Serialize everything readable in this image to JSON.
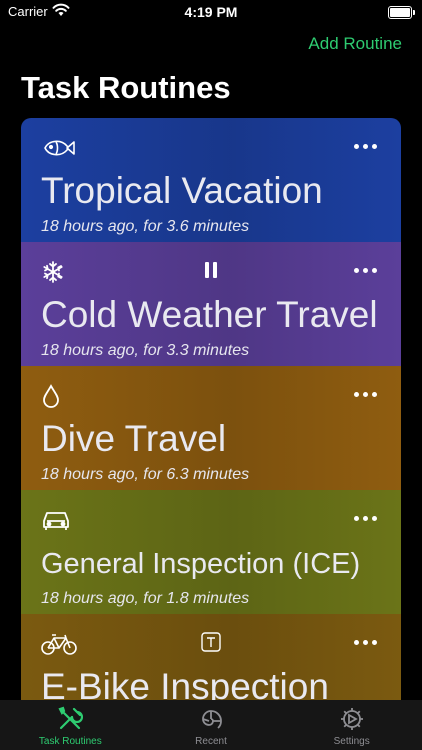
{
  "status": {
    "carrier": "Carrier",
    "time": "4:19 PM"
  },
  "header": {
    "add_label": "Add Routine",
    "title": "Task Routines"
  },
  "routines": [
    {
      "title": "Tropical Vacation",
      "subtitle": "18 hours ago, for 3.6 minutes",
      "icon": "fish-icon",
      "color": "#1c3fa0"
    },
    {
      "title": "Cold Weather Travel",
      "subtitle": "18 hours ago, for 3.3 minutes",
      "icon": "snowflake-icon",
      "badge_icon": "pause-icon",
      "color": "#5b3f9a"
    },
    {
      "title": "Dive Travel",
      "subtitle": "18 hours ago, for 6.3 minutes",
      "icon": "water-drop-icon",
      "color": "#8f5d10"
    },
    {
      "title": "General Inspection (ICE)",
      "subtitle": "18 hours ago, for 1.8 minutes",
      "icon": "car-icon",
      "color": "#6b7418"
    },
    {
      "title": "E-Bike Inspection",
      "icon": "bicycle-icon",
      "badge_icon": "text-t-icon",
      "color": "#7b5a10"
    }
  ],
  "tabs": [
    {
      "label": "Task Routines",
      "icon": "tools-icon",
      "active": true
    },
    {
      "label": "Recent",
      "icon": "nautilus-icon",
      "active": false
    },
    {
      "label": "Settings",
      "icon": "gear-icon",
      "active": false
    }
  ],
  "colors": {
    "accent": "#2ecc71",
    "tab_inactive": "#8e8e93"
  }
}
